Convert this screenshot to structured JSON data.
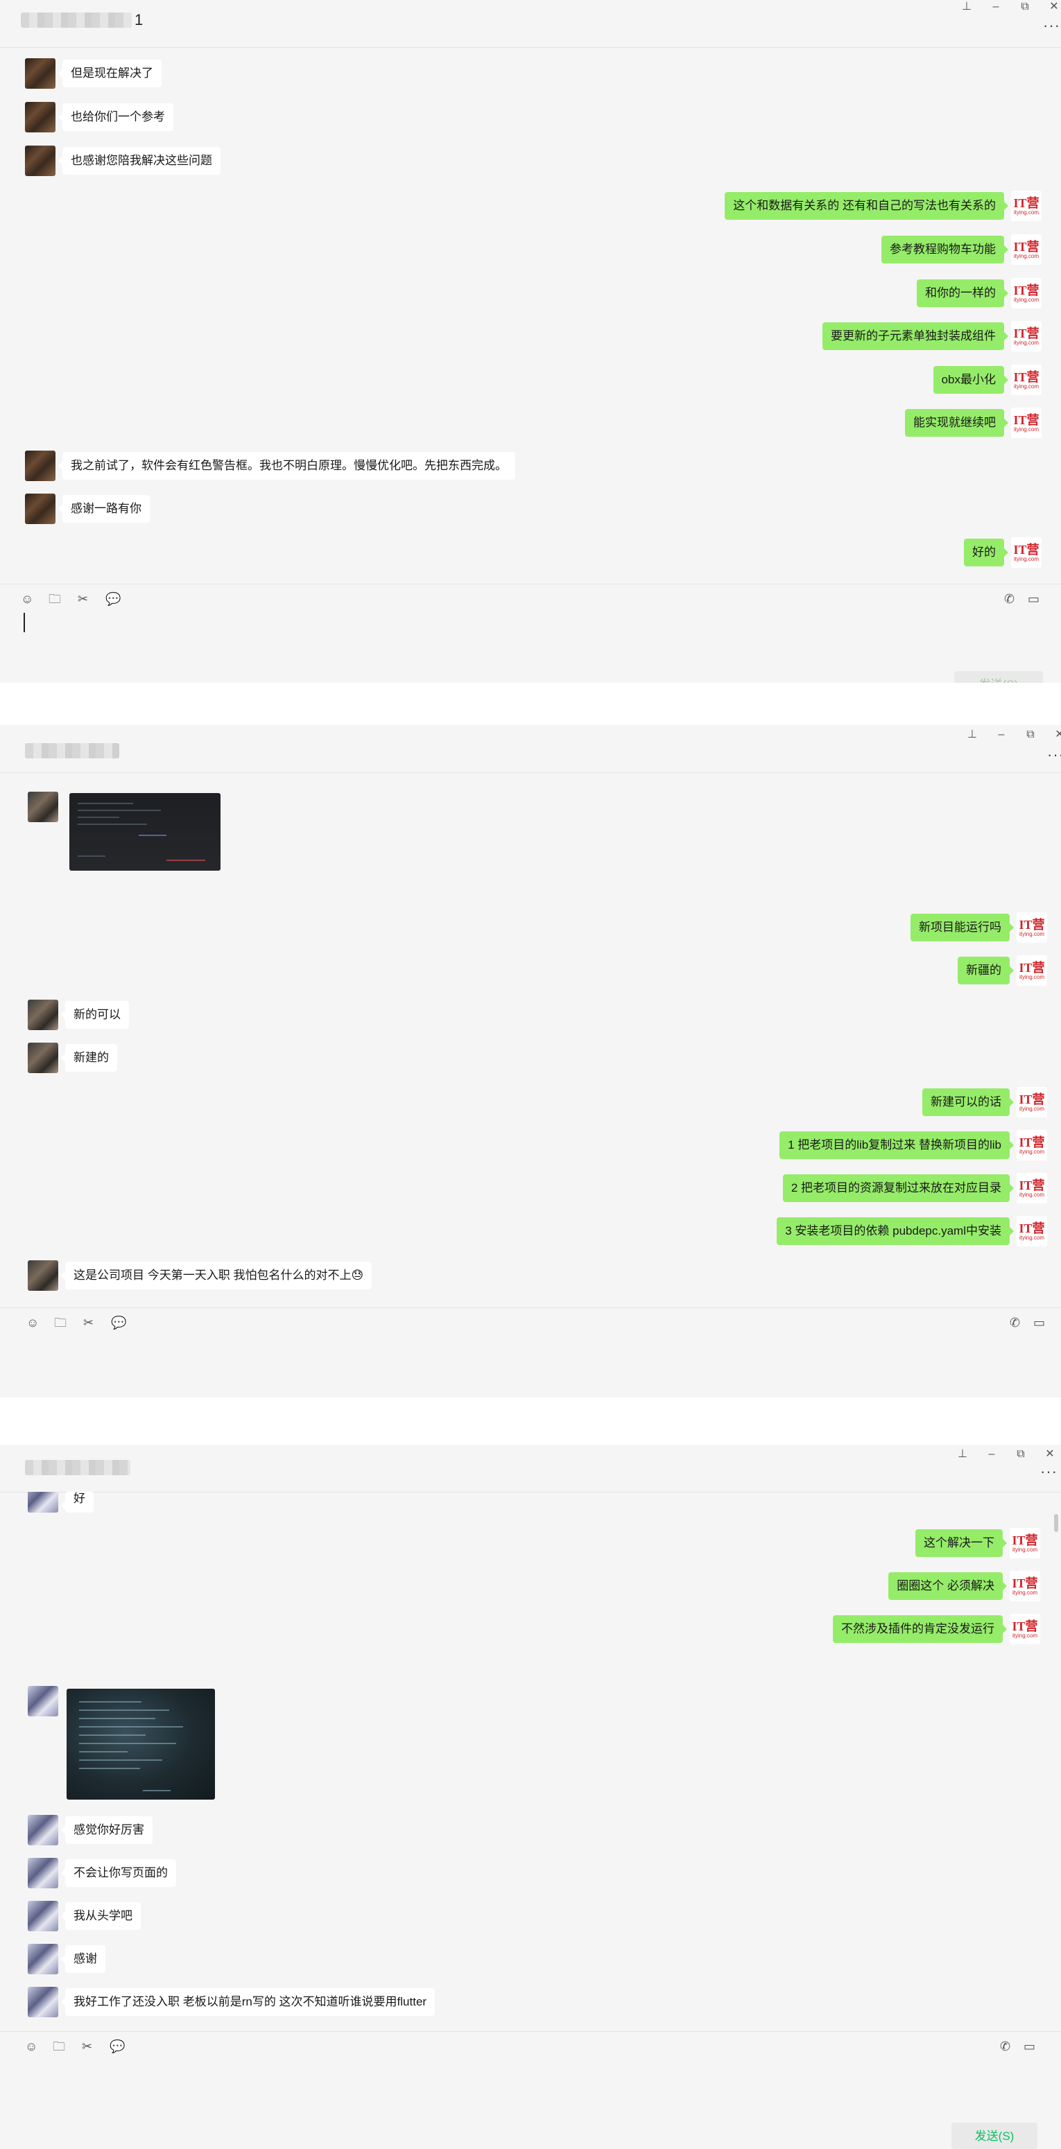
{
  "panels": [
    {
      "contact": {
        "name_suffix": "1"
      },
      "messages": [
        {
          "side": "left",
          "text": "但是现在解决了"
        },
        {
          "side": "left",
          "text": "也给你们一个参考"
        },
        {
          "side": "left",
          "text": "也感谢您陪我解决这些问题"
        },
        {
          "side": "right",
          "text": "这个和数据有关系的 还有和自己的写法也有关系的"
        },
        {
          "side": "right",
          "text": "参考教程购物车功能"
        },
        {
          "side": "right",
          "text": "和你的一样的"
        },
        {
          "side": "right",
          "text": "要更新的子元素单独封装成组件"
        },
        {
          "side": "right",
          "text": "obx最小化"
        },
        {
          "side": "right",
          "text": "能实现就继续吧"
        },
        {
          "side": "left",
          "text": "我之前试了，软件会有红色警告框。我也不明白原理。慢慢优化吧。先把东西完成。"
        },
        {
          "side": "left",
          "text": "感谢一路有你"
        },
        {
          "side": "right",
          "text": "好的"
        }
      ],
      "send_label": "发送(S)"
    },
    {
      "messages": [
        {
          "side": "right",
          "text": "新项目能运行吗"
        },
        {
          "side": "right",
          "text": "新疆的"
        },
        {
          "side": "left",
          "text": "新的可以"
        },
        {
          "side": "left",
          "text": "新建的"
        },
        {
          "side": "right",
          "text": "新建可以的话"
        },
        {
          "side": "right",
          "text": "1 把老项目的lib复制过来 替换新项目的lib"
        },
        {
          "side": "right",
          "text": "2 把老项目的资源复制过来放在对应目录"
        },
        {
          "side": "right",
          "text": "3 安装老项目的依赖 pubdepc.yaml中安装"
        },
        {
          "side": "left",
          "text": "这是公司项目  今天第一天入职 我怕包名什么的对不上😓"
        }
      ]
    },
    {
      "messages": [
        {
          "side": "left",
          "text": "好"
        },
        {
          "side": "right",
          "text": "这个解决一下"
        },
        {
          "side": "right",
          "text": "圈圈这个 必须解决"
        },
        {
          "side": "right",
          "text": "不然涉及插件的肯定没发运行"
        },
        {
          "side": "left",
          "text": "感觉你好厉害"
        },
        {
          "side": "left",
          "text": "不会让你写页面的"
        },
        {
          "side": "left",
          "text": "我从头学吧"
        },
        {
          "side": "left",
          "text": "感谢"
        },
        {
          "side": "left",
          "text": "我好工作了还没入职 老板以前是rn写的 这次不知道听谁说要用flutter"
        }
      ],
      "send_label": "发送(S)"
    }
  ],
  "icons": {
    "pin": "⊥",
    "minimize": "–",
    "restore": "⧉",
    "close": "✕",
    "more": "···",
    "emoji": "☺",
    "folder": "🗀",
    "scissors": "✂",
    "chat": "💬",
    "phone": "✆",
    "video": "▭"
  },
  "it_avatar": {
    "main": "IT营",
    "sub": "itying.com"
  },
  "colors": {
    "bubble_right": "#95ec69",
    "bubble_left": "#ffffff",
    "panel_bg": "#f5f5f5",
    "send_text": "#07c160"
  }
}
